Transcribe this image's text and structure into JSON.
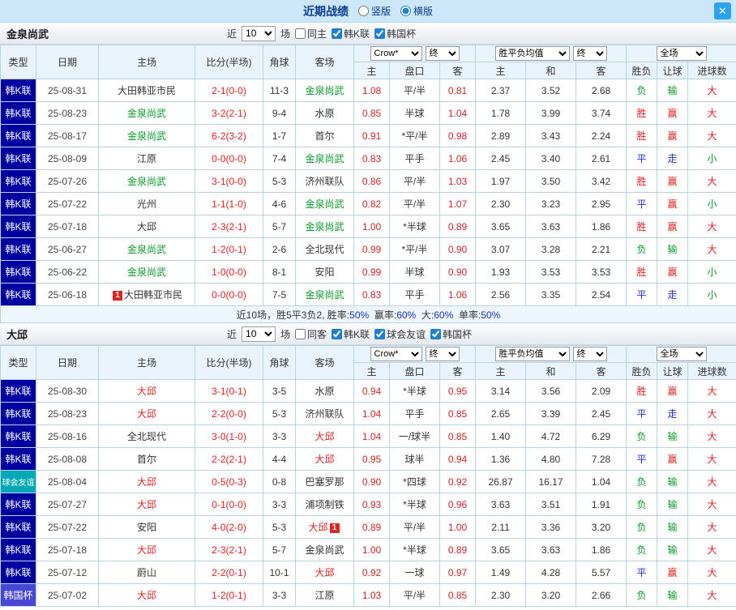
{
  "topbar": {
    "title": "近期战绩",
    "options": [
      {
        "label": "竖版",
        "selected": false
      },
      {
        "label": "横版",
        "selected": true
      }
    ],
    "close_label": "✕"
  },
  "controls": {
    "near": "近",
    "count": "10",
    "games": "场"
  },
  "header": {
    "type": "类型",
    "date": "日期",
    "home": "主场",
    "score": "比分(半场)",
    "corner": "角球",
    "away": "客场",
    "home_short": "主",
    "away_short": "客",
    "handicap": "盘口",
    "draw": "和",
    "result": "胜负",
    "let_result": "让球",
    "goals": "进球数",
    "selects": {
      "company": "Crow*",
      "final": "终",
      "wdl_avg": "胜平负均值",
      "full": "全场"
    }
  },
  "type_colors": {
    "韩K联": "#0000a0",
    "球会友谊": "#00a9b5",
    "韩国杯": "#4747d3"
  },
  "result_colors": {
    "胜": "#e02222",
    "赢": "#e02222",
    "大": "#e02222",
    "平": "#2230dd",
    "走": "#2230dd",
    "负": "#0a9a2a",
    "输": "#0a9a2a",
    "小": "#0a9a2a"
  },
  "sections": [
    {
      "team": "金泉尚武",
      "focus_color": "#0a9a2a",
      "filters": [
        {
          "label": "同主",
          "checked": false
        },
        {
          "label": "韩K联",
          "checked": true
        },
        {
          "label": "韩国杯",
          "checked": true
        }
      ],
      "rows": [
        {
          "type": "韩K联",
          "date": "25-08-31",
          "home": "大田韩亚市民",
          "home_focus": false,
          "home_badge": "",
          "score": "2-1(0-0)",
          "corner": "11-3",
          "away": "金泉尚武",
          "away_focus": true,
          "away_badge": "",
          "odds": [
            "1.08",
            "平/半",
            "0.81"
          ],
          "avg": [
            "2.37",
            "3.52",
            "2.68"
          ],
          "results": [
            "负",
            "输",
            "大"
          ]
        },
        {
          "type": "韩K联",
          "date": "25-08-23",
          "home": "金泉尚武",
          "home_focus": true,
          "home_badge": "",
          "score": "3-2(2-1)",
          "corner": "9-4",
          "away": "水原",
          "away_focus": false,
          "away_badge": "",
          "odds": [
            "0.85",
            "半球",
            "1.04"
          ],
          "avg": [
            "1.78",
            "3.99",
            "3.74"
          ],
          "results": [
            "胜",
            "赢",
            "大"
          ]
        },
        {
          "type": "韩K联",
          "date": "25-08-17",
          "home": "金泉尚武",
          "home_focus": true,
          "home_badge": "",
          "score": "6-2(3-2)",
          "corner": "1-7",
          "away": "首尔",
          "away_focus": false,
          "away_badge": "",
          "odds": [
            "0.91",
            "*平/半",
            "0.98"
          ],
          "avg": [
            "2.89",
            "3.43",
            "2.24"
          ],
          "results": [
            "胜",
            "赢",
            "大"
          ]
        },
        {
          "type": "韩K联",
          "date": "25-08-09",
          "home": "江原",
          "home_focus": false,
          "home_badge": "",
          "score": "0-0(0-0)",
          "corner": "7-4",
          "away": "金泉尚武",
          "away_focus": true,
          "away_badge": "",
          "odds": [
            "0.83",
            "平手",
            "1.06"
          ],
          "avg": [
            "2.45",
            "3.40",
            "2.61"
          ],
          "results": [
            "平",
            "走",
            "小"
          ]
        },
        {
          "type": "韩K联",
          "date": "25-07-26",
          "home": "金泉尚武",
          "home_focus": true,
          "home_badge": "",
          "score": "3-1(0-0)",
          "corner": "5-3",
          "away": "济州联队",
          "away_focus": false,
          "away_badge": "",
          "odds": [
            "0.86",
            "平/半",
            "1.03"
          ],
          "avg": [
            "1.97",
            "3.50",
            "3.42"
          ],
          "results": [
            "胜",
            "赢",
            "大"
          ]
        },
        {
          "type": "韩K联",
          "date": "25-07-22",
          "home": "光州",
          "home_focus": false,
          "home_badge": "",
          "score": "1-1(1-0)",
          "corner": "4-6",
          "away": "金泉尚武",
          "away_focus": true,
          "away_badge": "",
          "odds": [
            "0.82",
            "平/半",
            "1.07"
          ],
          "avg": [
            "2.30",
            "3.23",
            "2.95"
          ],
          "results": [
            "平",
            "赢",
            "小"
          ]
        },
        {
          "type": "韩K联",
          "date": "25-07-18",
          "home": "大邱",
          "home_focus": false,
          "home_badge": "",
          "score": "2-3(2-1)",
          "corner": "5-7",
          "away": "金泉尚武",
          "away_focus": true,
          "away_badge": "",
          "odds": [
            "1.00",
            "*半球",
            "0.89"
          ],
          "avg": [
            "3.65",
            "3.63",
            "1.86"
          ],
          "results": [
            "胜",
            "赢",
            "大"
          ]
        },
        {
          "type": "韩K联",
          "date": "25-06-27",
          "home": "金泉尚武",
          "home_focus": true,
          "home_badge": "",
          "score": "1-2(0-1)",
          "corner": "2-6",
          "away": "全北现代",
          "away_focus": false,
          "away_badge": "",
          "odds": [
            "0.99",
            "*平/半",
            "0.90"
          ],
          "avg": [
            "3.07",
            "3.28",
            "2.21"
          ],
          "results": [
            "负",
            "输",
            "大"
          ]
        },
        {
          "type": "韩K联",
          "date": "25-06-22",
          "home": "金泉尚武",
          "home_focus": true,
          "home_badge": "",
          "score": "1-0(0-0)",
          "corner": "8-1",
          "away": "安阳",
          "away_focus": false,
          "away_badge": "",
          "odds": [
            "0.99",
            "半球",
            "0.90"
          ],
          "avg": [
            "1.93",
            "3.53",
            "3.53"
          ],
          "results": [
            "胜",
            "赢",
            "小"
          ]
        },
        {
          "type": "韩K联",
          "date": "25-06-18",
          "home": "大田韩亚市民",
          "home_focus": false,
          "home_badge": "1",
          "score": "0-0(0-0)",
          "corner": "7-5",
          "away": "金泉尚武",
          "away_focus": true,
          "away_badge": "",
          "odds": [
            "0.83",
            "平手",
            "1.06"
          ],
          "avg": [
            "2.56",
            "3.35",
            "2.54"
          ],
          "results": [
            "平",
            "走",
            "小"
          ]
        }
      ],
      "summary": {
        "text": "近10场，胜5平3负2,",
        "stats": [
          {
            "label": "胜率",
            "value": "50%"
          },
          {
            "label": "赢率",
            "value": "60%"
          },
          {
            "label": "大",
            "value": "60%"
          },
          {
            "label": "单率",
            "value": "50%"
          }
        ]
      }
    },
    {
      "team": "大邱",
      "focus_color": "#e02222",
      "filters": [
        {
          "label": "同客",
          "checked": false
        },
        {
          "label": "韩K联",
          "checked": true
        },
        {
          "label": "球会友谊",
          "checked": true
        },
        {
          "label": "韩国杯",
          "checked": true
        }
      ],
      "rows": [
        {
          "type": "韩K联",
          "date": "25-08-30",
          "home": "大邱",
          "home_focus": true,
          "home_badge": "",
          "score": "3-1(0-1)",
          "corner": "3-5",
          "away": "水原",
          "away_focus": false,
          "away_badge": "",
          "odds": [
            "0.94",
            "*半球",
            "0.95"
          ],
          "avg": [
            "3.14",
            "3.56",
            "2.09"
          ],
          "results": [
            "胜",
            "赢",
            "大"
          ]
        },
        {
          "type": "韩K联",
          "date": "25-08-23",
          "home": "大邱",
          "home_focus": true,
          "home_badge": "",
          "score": "2-2(0-0)",
          "corner": "5-3",
          "away": "济州联队",
          "away_focus": false,
          "away_badge": "",
          "odds": [
            "1.04",
            "平手",
            "0.85"
          ],
          "avg": [
            "2.65",
            "3.39",
            "2.45"
          ],
          "results": [
            "平",
            "走",
            "大"
          ]
        },
        {
          "type": "韩K联",
          "date": "25-08-16",
          "home": "全北现代",
          "home_focus": false,
          "home_badge": "",
          "score": "3-0(1-0)",
          "corner": "3-3",
          "away": "大邱",
          "away_focus": true,
          "away_badge": "",
          "odds": [
            "1.04",
            "一/球半",
            "0.85"
          ],
          "avg": [
            "1.40",
            "4.72",
            "6.29"
          ],
          "results": [
            "负",
            "输",
            "大"
          ]
        },
        {
          "type": "韩K联",
          "date": "25-08-08",
          "home": "首尔",
          "home_focus": false,
          "home_badge": "",
          "score": "2-2(2-1)",
          "corner": "4-4",
          "away": "大邱",
          "away_focus": true,
          "away_badge": "",
          "odds": [
            "0.95",
            "球半",
            "0.94"
          ],
          "avg": [
            "1.36",
            "4.80",
            "7.28"
          ],
          "results": [
            "平",
            "赢",
            "大"
          ]
        },
        {
          "type": "球会友谊",
          "date": "25-08-04",
          "home": "大邱",
          "home_focus": true,
          "home_badge": "",
          "score": "0-5(0-3)",
          "corner": "0-8",
          "away": "巴塞罗那",
          "away_focus": false,
          "away_badge": "",
          "odds": [
            "0.90",
            "*四球",
            "0.92"
          ],
          "avg": [
            "26.87",
            "16.17",
            "1.04"
          ],
          "results": [
            "负",
            "输",
            "大"
          ]
        },
        {
          "type": "韩K联",
          "date": "25-07-27",
          "home": "大邱",
          "home_focus": true,
          "home_badge": "",
          "score": "0-1(0-0)",
          "corner": "3-3",
          "away": "浦项制铁",
          "away_focus": false,
          "away_badge": "",
          "odds": [
            "0.93",
            "*半球",
            "0.96"
          ],
          "avg": [
            "3.63",
            "3.51",
            "1.91"
          ],
          "results": [
            "负",
            "输",
            "大"
          ]
        },
        {
          "type": "韩K联",
          "date": "25-07-22",
          "home": "安阳",
          "home_focus": false,
          "home_badge": "",
          "score": "4-0(2-0)",
          "corner": "5-3",
          "away": "大邱",
          "away_focus": true,
          "away_badge": "1",
          "odds": [
            "0.89",
            "平/半",
            "1.00"
          ],
          "avg": [
            "2.11",
            "3.36",
            "3.20"
          ],
          "results": [
            "负",
            "输",
            "大"
          ]
        },
        {
          "type": "韩K联",
          "date": "25-07-18",
          "home": "大邱",
          "home_focus": true,
          "home_badge": "",
          "score": "2-3(2-1)",
          "corner": "5-7",
          "away": "金泉尚武",
          "away_focus": false,
          "away_badge": "",
          "odds": [
            "1.00",
            "*半球",
            "0.89"
          ],
          "avg": [
            "3.65",
            "3.63",
            "1.86"
          ],
          "results": [
            "负",
            "输",
            "大"
          ]
        },
        {
          "type": "韩K联",
          "date": "25-07-12",
          "home": "蔚山",
          "home_focus": false,
          "home_badge": "",
          "score": "2-2(0-1)",
          "corner": "10-1",
          "away": "大邱",
          "away_focus": true,
          "away_badge": "",
          "odds": [
            "0.92",
            "一球",
            "0.97"
          ],
          "avg": [
            "1.49",
            "4.28",
            "5.57"
          ],
          "results": [
            "平",
            "赢",
            "大"
          ]
        },
        {
          "type": "韩国杯",
          "date": "25-07-02",
          "home": "大邱",
          "home_focus": true,
          "home_badge": "",
          "score": "1-2(0-1)",
          "corner": "3-3",
          "away": "江原",
          "away_focus": false,
          "away_badge": "",
          "odds": [
            "1.03",
            "平/半",
            "0.85"
          ],
          "avg": [
            "2.30",
            "3.20",
            "2.66"
          ],
          "results": [
            "负",
            "输",
            "大"
          ]
        }
      ],
      "summary": null
    }
  ]
}
